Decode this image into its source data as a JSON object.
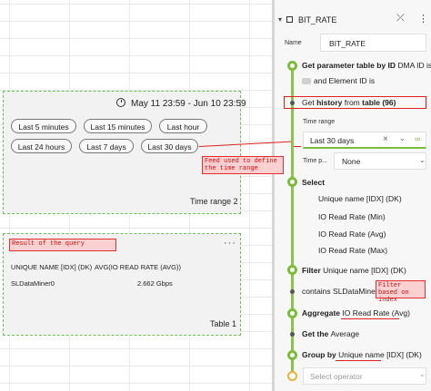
{
  "dashboard": {
    "date_range": "May 11 23:59 - Jun 10 23:59",
    "presets": [
      "Last 5 minutes",
      "Last 15 minutes",
      "Last hour",
      "Last 24 hours",
      "Last 7 days",
      "Last 30 days"
    ],
    "widget1_caption": "Time range 2",
    "table": {
      "headers": [
        "UNIQUE NAME [IDX] (DK)",
        "AVG(IO READ RATE (AVG))"
      ],
      "rows": [
        [
          "SLDataMiner0",
          "2.662 Gbps"
        ]
      ],
      "caption": "Table 1"
    }
  },
  "annotations": {
    "feed": "Feed used to define the time range",
    "result": "Result of the query",
    "filter": "Filter based on index"
  },
  "panel": {
    "title": "BIT_RATE",
    "name_label": "Name",
    "name_value": "BIT_RATE",
    "step1_bold": "Get parameter table by ID",
    "step1_rest": " DMA ID is",
    "step1_line2": "and Element ID is",
    "history_pre": "Get ",
    "history_bold1": "history",
    "history_mid": " from ",
    "history_bold2": "table (96)",
    "time_range_label": "Time range",
    "time_range_value": "Last 30 days",
    "time_p_label": "Time p...",
    "time_p_value": "None",
    "select_label": "Select",
    "select_items": [
      "Unique name [IDX] (DK)",
      "IO Read Rate (Min)",
      "IO Read Rate (Avg)",
      "IO Read Rate (Max)"
    ],
    "filter_bold": "Filter",
    "filter_rest": " Unique name [IDX] (DK)",
    "contains": "contains SLDataMiner",
    "aggregate_bold": "Aggregate",
    "aggregate_rest": " IO Read Rate (Avg)",
    "get_the_pre": "Get the ",
    "get_the_rest": "Average",
    "group_bold": "Group by",
    "group_rest": " Unique name [IDX] (DK)",
    "select_operator": "Select operator"
  },
  "colors": {
    "accent_green": "#7cbc3c",
    "annotation_red": "#e02020"
  }
}
